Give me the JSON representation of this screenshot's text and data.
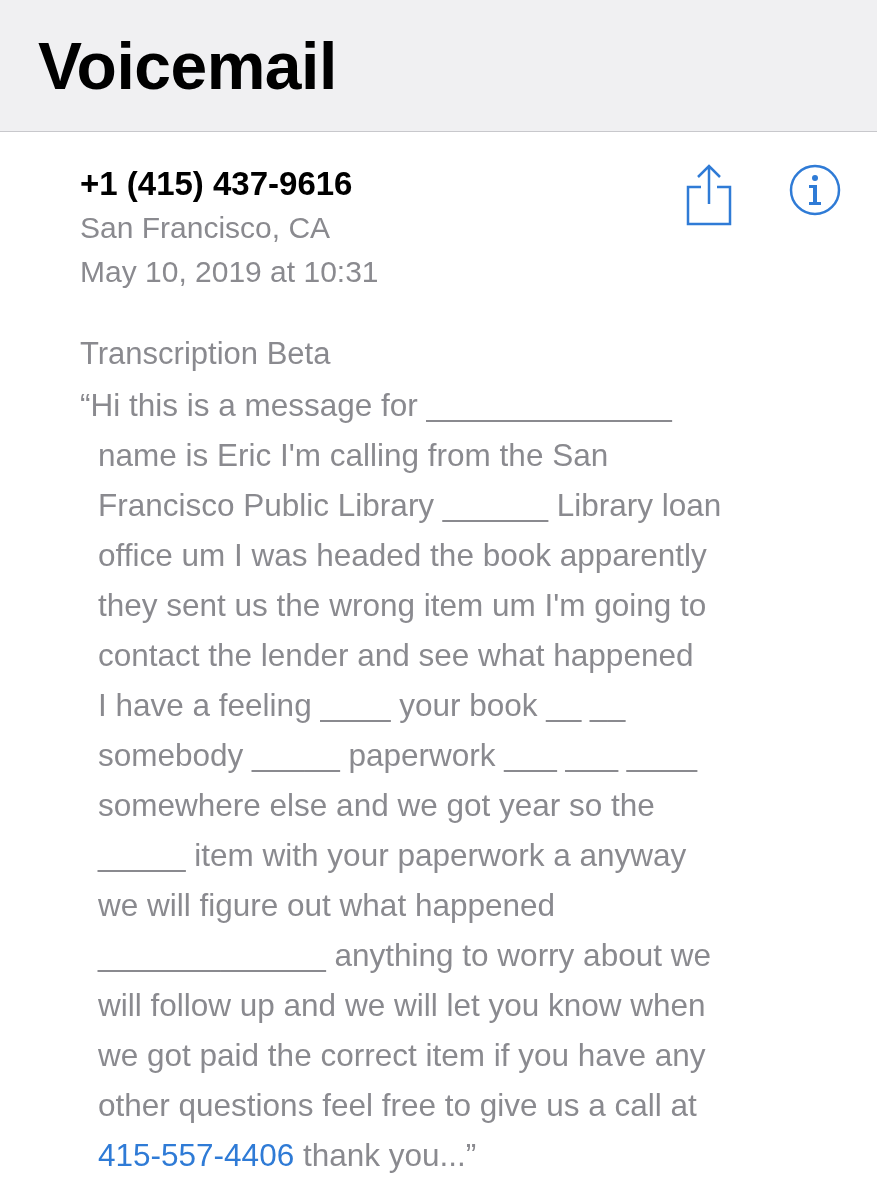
{
  "header": {
    "title": "Voicemail"
  },
  "voicemail": {
    "caller": "+1 (415) 437-9616",
    "location": "San Francisco, CA",
    "date": "May 10, 2019 at 10:31"
  },
  "transcription": {
    "label": "Transcription Beta",
    "lines": [
      "“Hi this is a message for ______________",
      "name is Eric I'm calling from the San",
      "Francisco Public Library ______ Library loan",
      "office um I was headed the book apparently",
      "they sent us the wrong item um I'm going to",
      "contact the lender and see what happened",
      "I have a feeling ____ your book __ __",
      "somebody _____ paperwork ___ ___ ____",
      "somewhere else and we got year so the",
      "_____ item with your paperwork a anyway",
      "we will figure out what happened",
      "_____________ anything to worry about we",
      "will follow up and we will let you know when",
      "we got paid the correct item if you have any",
      "other questions feel free to give us a call at"
    ],
    "phone_link": "415-557-4406",
    "ending": " thank you...”"
  }
}
